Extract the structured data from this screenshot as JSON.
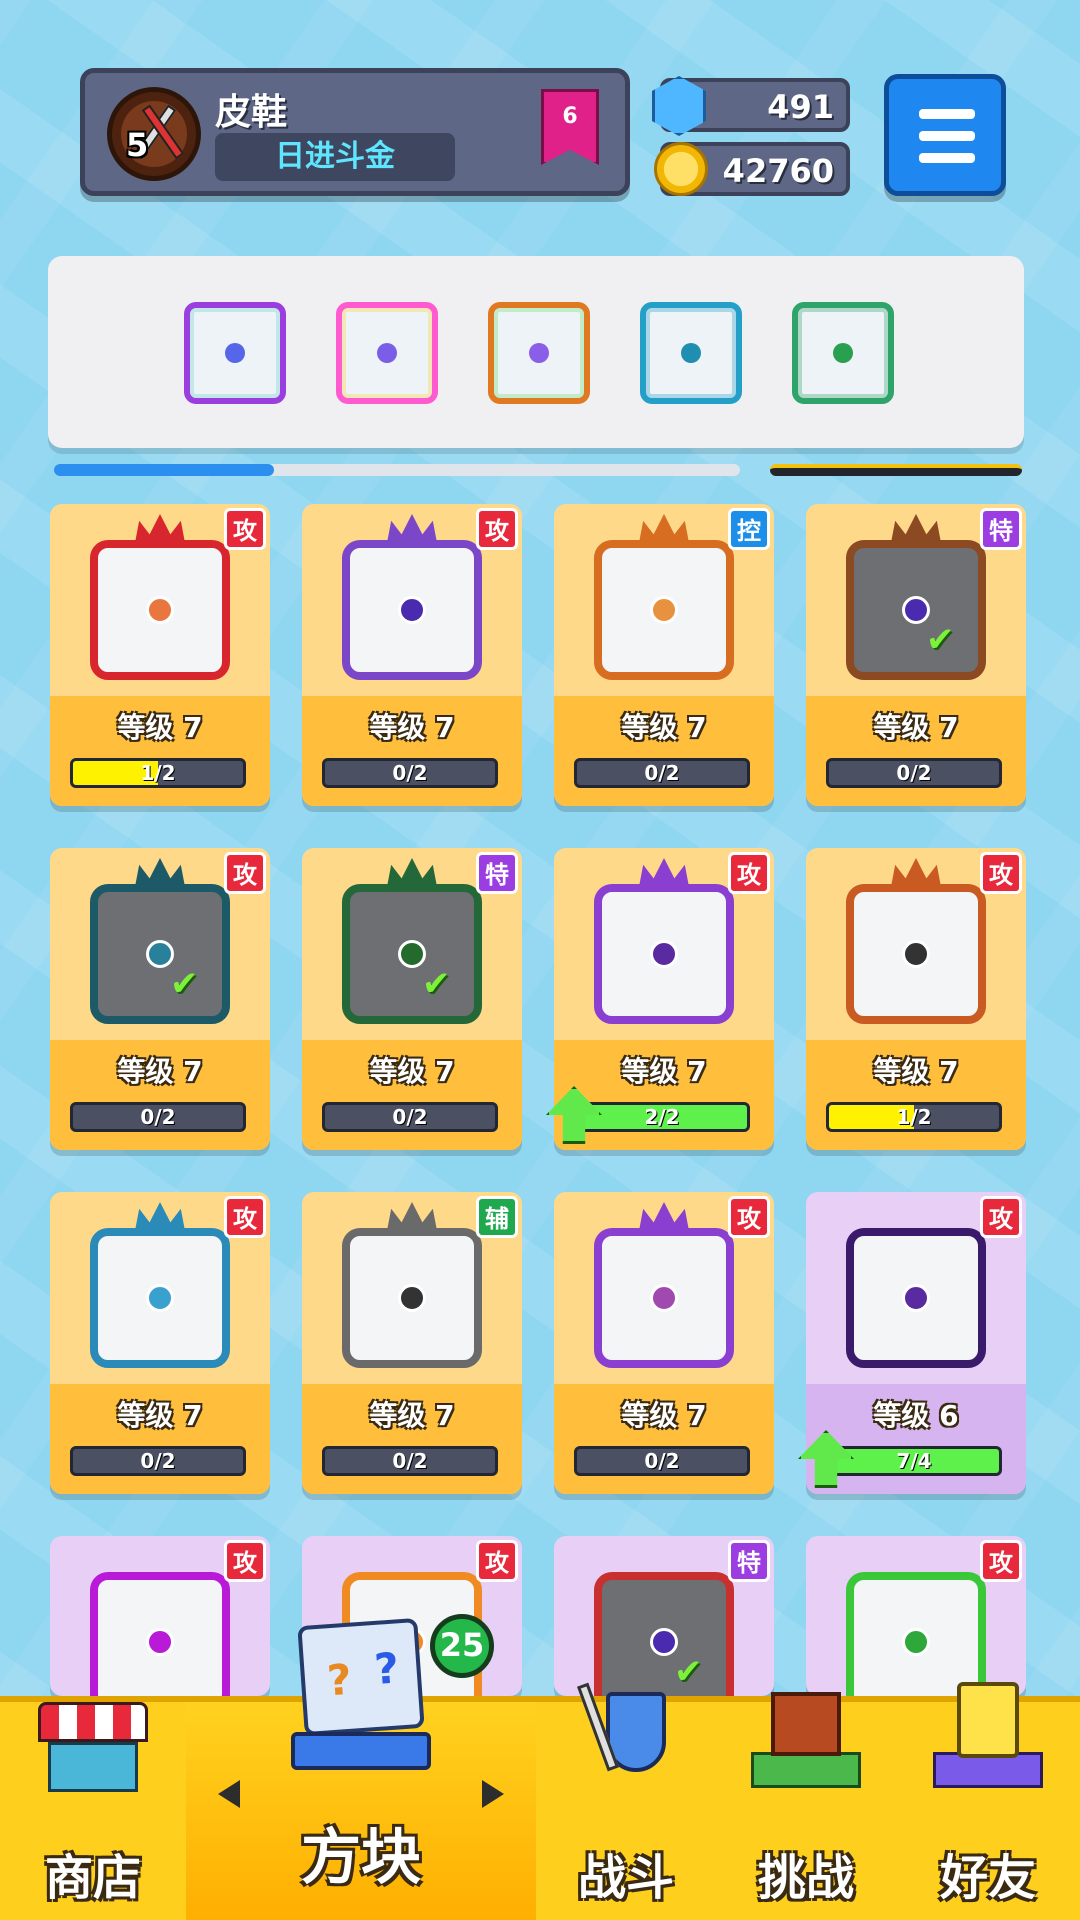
{
  "player": {
    "name": "皮鞋",
    "title": "日进斗金",
    "level": "5",
    "rank": "6"
  },
  "currencies": {
    "gems": "491",
    "coins": "42760"
  },
  "equipped": [
    {
      "border": "#9a3ee0",
      "accent": "#6dd0c9",
      "dot": "#5567e8"
    },
    {
      "border": "#ff5ad0",
      "accent": "#ffd03d",
      "dot": "#7b5ee8"
    },
    {
      "border": "#e07a22",
      "accent": "#6ddf6d",
      "dot": "#8a5ee8"
    },
    {
      "border": "#24a0c8",
      "accent": "#24a0c8",
      "dot": "#1f8eb0"
    },
    {
      "border": "#2ea36a",
      "accent": "#2ea36a",
      "dot": "#28a050"
    }
  ],
  "strip_progress": 0.32,
  "cards": [
    {
      "tag": "攻",
      "tag_class": "atk",
      "level": "等级 7",
      "progress": "1/2",
      "fill": 0.5,
      "fill_color": "y",
      "frame": "#d8262f",
      "dot": "#e8763e",
      "style": "gold",
      "dark": false,
      "check": false,
      "up": false
    },
    {
      "tag": "攻",
      "tag_class": "atk",
      "level": "等级 7",
      "progress": "0/2",
      "fill": 0,
      "fill_color": "y",
      "frame": "#7b47c8",
      "dot": "#4a2bb0",
      "style": "gold",
      "dark": false,
      "check": false,
      "up": false
    },
    {
      "tag": "控",
      "tag_class": "ctl",
      "level": "等级 7",
      "progress": "0/2",
      "fill": 0,
      "fill_color": "y",
      "frame": "#d66d20",
      "dot": "#e8913e",
      "style": "gold",
      "dark": false,
      "check": false,
      "up": false
    },
    {
      "tag": "特",
      "tag_class": "spc",
      "level": "等级 7",
      "progress": "0/2",
      "fill": 0,
      "fill_color": "y",
      "frame": "#8b4a22",
      "dot": "#4a2bb0",
      "style": "gold",
      "dark": true,
      "check": true,
      "up": false
    },
    {
      "tag": "攻",
      "tag_class": "atk",
      "level": "等级 7",
      "progress": "0/2",
      "fill": 0,
      "fill_color": "y",
      "frame": "#1d5a68",
      "dot": "#29809a",
      "style": "gold",
      "dark": true,
      "check": true,
      "up": false
    },
    {
      "tag": "特",
      "tag_class": "spc",
      "level": "等级 7",
      "progress": "0/2",
      "fill": 0,
      "fill_color": "y",
      "frame": "#24683a",
      "dot": "#246a2c",
      "style": "gold",
      "dark": true,
      "check": true,
      "up": false
    },
    {
      "tag": "攻",
      "tag_class": "atk",
      "level": "等级 7",
      "progress": "2/2",
      "fill": 1,
      "fill_color": "g",
      "frame": "#8a3fd0",
      "dot": "#5a2aa0",
      "style": "gold",
      "dark": false,
      "check": false,
      "up": true
    },
    {
      "tag": "攻",
      "tag_class": "atk",
      "level": "等级 7",
      "progress": "1/2",
      "fill": 0.5,
      "fill_color": "y",
      "frame": "#c85a22",
      "dot": "#333333",
      "style": "gold",
      "dark": false,
      "check": false,
      "up": false
    },
    {
      "tag": "攻",
      "tag_class": "atk",
      "level": "等级 7",
      "progress": "0/2",
      "fill": 0,
      "fill_color": "y",
      "frame": "#2a8ab8",
      "dot": "#3aa0d0",
      "style": "gold",
      "dark": false,
      "check": false,
      "up": false
    },
    {
      "tag": "辅",
      "tag_class": "sup",
      "level": "等级 7",
      "progress": "0/2",
      "fill": 0,
      "fill_color": "y",
      "frame": "#6a6a6a",
      "dot": "#333333",
      "style": "gold",
      "dark": false,
      "check": false,
      "up": false
    },
    {
      "tag": "攻",
      "tag_class": "atk",
      "level": "等级 7",
      "progress": "0/2",
      "fill": 0,
      "fill_color": "y",
      "frame": "#8a3fd0",
      "dot": "#a04ab0",
      "style": "gold",
      "dark": false,
      "check": false,
      "up": false
    },
    {
      "tag": "攻",
      "tag_class": "atk",
      "level": "等级 6",
      "progress": "7/4",
      "fill": 1,
      "fill_color": "g",
      "frame": "#3a1a6a",
      "dot": "#5a2aa0",
      "style": "purple",
      "dark": false,
      "check": false,
      "up": true
    },
    {
      "tag": "攻",
      "tag_class": "atk",
      "level": "",
      "progress": "",
      "fill": 0,
      "fill_color": "y",
      "frame": "#b81ad8",
      "dot": "#b81ad8",
      "style": "purple",
      "dark": false,
      "check": false,
      "up": false
    },
    {
      "tag": "攻",
      "tag_class": "atk",
      "level": "",
      "progress": "",
      "fill": 0,
      "fill_color": "y",
      "frame": "#f08a22",
      "dot": "#f08a22",
      "style": "purple",
      "dark": false,
      "check": false,
      "up": false
    },
    {
      "tag": "特",
      "tag_class": "spc",
      "level": "",
      "progress": "",
      "fill": 0,
      "fill_color": "y",
      "frame": "#c83030",
      "dot": "#4a2bb0",
      "style": "purple",
      "dark": true,
      "check": true,
      "up": false
    },
    {
      "tag": "攻",
      "tag_class": "atk",
      "level": "",
      "progress": "",
      "fill": 0,
      "fill_color": "y",
      "frame": "#3ac83a",
      "dot": "#2ea83a",
      "style": "purple",
      "dark": false,
      "check": false,
      "up": false
    }
  ],
  "nav": {
    "shop": "商店",
    "blocks": "方块",
    "battle": "战斗",
    "challenge": "挑战",
    "friends": "好友",
    "blocks_badge": "25"
  }
}
